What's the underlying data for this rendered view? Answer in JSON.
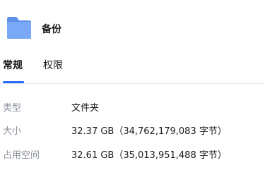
{
  "header": {
    "icon": "folder-icon",
    "title": "备份"
  },
  "tabs": [
    {
      "label": "常规",
      "active": true
    },
    {
      "label": "权限",
      "active": false
    }
  ],
  "properties": {
    "type": {
      "label": "类型",
      "value": "文件夹"
    },
    "size": {
      "label": "大小",
      "value": "32.37 GB（34,762,179,083 字节）"
    },
    "size_on_disk": {
      "label": "占用空间",
      "value": "32.61 GB（35,013,951,488 字节）"
    }
  },
  "colors": {
    "accent": "#2f6bff",
    "folder_front": "#79a8f7",
    "folder_back": "#5c8fe8",
    "label_text": "#8a8f99",
    "divider": "#e3e6ea"
  }
}
